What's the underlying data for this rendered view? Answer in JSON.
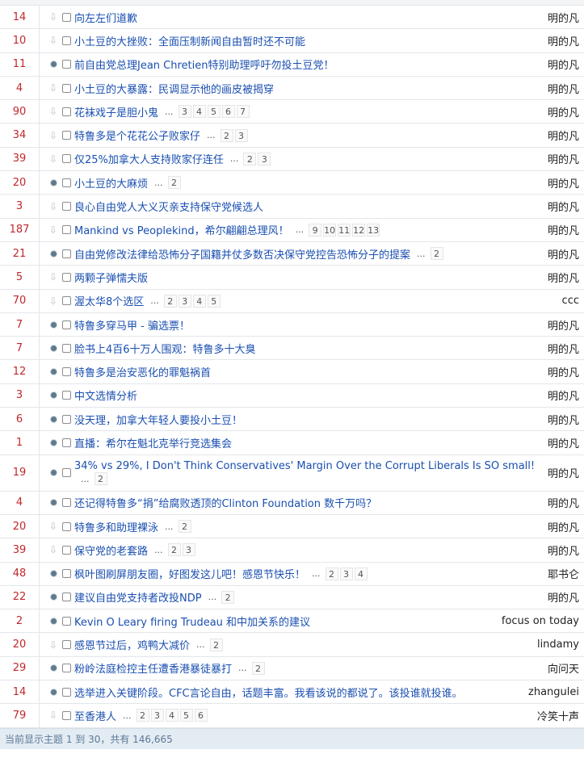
{
  "topics": [
    {
      "count": "14",
      "icon": "arrow",
      "title": "向左左们道歉",
      "pages": [],
      "author": "明的凡"
    },
    {
      "count": "10",
      "icon": "arrow",
      "title": "小土豆的大挫败：全面压制新闻自由暂时还不可能",
      "pages": [],
      "author": "明的凡"
    },
    {
      "count": "11",
      "icon": "dot",
      "title": "前自由党总理Jean Chretien特别助理呼吁勿投土豆党！",
      "pages": [],
      "author": "明的凡"
    },
    {
      "count": "4",
      "icon": "arrow",
      "title": "小土豆的大暴露：民调显示他的画皮被揭穿",
      "pages": [],
      "author": "明的凡"
    },
    {
      "count": "90",
      "icon": "arrow",
      "title": "花袜戏子是胆小鬼",
      "pages": [
        "3",
        "4",
        "5",
        "6",
        "7"
      ],
      "author": "明的凡"
    },
    {
      "count": "34",
      "icon": "arrow",
      "title": "特鲁多是个花花公子败家仔",
      "pages": [
        "2",
        "3"
      ],
      "author": "明的凡"
    },
    {
      "count": "39",
      "icon": "arrow",
      "title": "仅25%加拿大人支持败家仔连任",
      "pages": [
        "2",
        "3"
      ],
      "author": "明的凡"
    },
    {
      "count": "20",
      "icon": "dot",
      "title": "小土豆的大麻烦",
      "pages": [
        "2"
      ],
      "author": "明的凡"
    },
    {
      "count": "3",
      "icon": "arrow",
      "title": "良心自由党人大义灭亲支持保守党候选人",
      "pages": [],
      "author": "明的凡"
    },
    {
      "count": "187",
      "icon": "arrow",
      "title": "Mankind vs Peoplekind，希尔翩翩总理风！",
      "pages": [
        "9",
        "10",
        "11",
        "12",
        "13"
      ],
      "author": "明的凡"
    },
    {
      "count": "21",
      "icon": "dot",
      "title": "自由党修改法律给恐怖分子国籍并仗多数否决保守党控告恐怖分子的提案",
      "pages": [
        "2"
      ],
      "author": "明的凡"
    },
    {
      "count": "5",
      "icon": "arrow",
      "title": "两颗子弹懦夫版",
      "pages": [],
      "author": "明的凡"
    },
    {
      "count": "70",
      "icon": "arrow",
      "title": "渥太华8个选区",
      "pages": [
        "2",
        "3",
        "4",
        "5"
      ],
      "author": "ccc"
    },
    {
      "count": "7",
      "icon": "dot",
      "title": "特鲁多穿马甲 - 骗选票！",
      "pages": [],
      "author": "明的凡"
    },
    {
      "count": "7",
      "icon": "dot",
      "title": "脸书上4百6十万人围观：特鲁多十大臭",
      "pages": [],
      "author": "明的凡"
    },
    {
      "count": "12",
      "icon": "dot",
      "title": "特鲁多是治安恶化的罪魁祸首",
      "pages": [],
      "author": "明的凡"
    },
    {
      "count": "3",
      "icon": "dot",
      "title": "中文选情分析",
      "pages": [],
      "author": "明的凡"
    },
    {
      "count": "6",
      "icon": "dot",
      "title": "没天理，加拿大年轻人要投小土豆！",
      "pages": [],
      "author": "明的凡"
    },
    {
      "count": "1",
      "icon": "dot",
      "title": "直播：希尔在魁北克举行竞选集会",
      "pages": [],
      "author": "明的凡"
    },
    {
      "count": "19",
      "icon": "dot",
      "title": "34% vs 29%, I Don't Think Conservatives' Margin Over the Corrupt Liberals Is SO small!",
      "pages": [
        "2"
      ],
      "author": "明的凡",
      "tall": true
    },
    {
      "count": "4",
      "icon": "dot",
      "title": "还记得特鲁多“捐”给腐败透顶的Clinton Foundation 数千万吗？",
      "pages": [],
      "author": "明的凡"
    },
    {
      "count": "20",
      "icon": "arrow",
      "title": "特鲁多和助理裸泳",
      "pages": [
        "2"
      ],
      "author": "明的凡"
    },
    {
      "count": "39",
      "icon": "arrow",
      "title": "保守党的老套路",
      "pages": [
        "2",
        "3"
      ],
      "author": "明的凡"
    },
    {
      "count": "48",
      "icon": "dot",
      "title": "枫叶图刷屏朋友圈，好图发这儿吧！感恩节快乐！",
      "pages": [
        "2",
        "3",
        "4"
      ],
      "author": "耶书仑"
    },
    {
      "count": "22",
      "icon": "dot",
      "title": "建议自由党支持者改投NDP",
      "pages": [
        "2"
      ],
      "author": "明的凡"
    },
    {
      "count": "2",
      "icon": "dot",
      "title": "Kevin O Leary firing Trudeau 和中加关系的建议",
      "pages": [],
      "author": "focus on today"
    },
    {
      "count": "20",
      "icon": "arrow",
      "title": "感恩节过后，鸡鸭大减价",
      "pages": [
        "2"
      ],
      "author": "lindamy"
    },
    {
      "count": "29",
      "icon": "dot",
      "title": "粉岭法庭检控主任遭香港暴徒暴打",
      "pages": [
        "2"
      ],
      "author": "向问天"
    },
    {
      "count": "14",
      "icon": "dot",
      "title": "选举进入关键阶段。CFC言论自由，话题丰富。我看该说的都说了。该投谁就投谁。",
      "pages": [],
      "author": "zhangulei"
    },
    {
      "count": "79",
      "icon": "arrow",
      "title": "至香港人",
      "pages": [
        "2",
        "3",
        "4",
        "5",
        "6"
      ],
      "author": "冷笑十声"
    }
  ],
  "ellipsis": "...",
  "footer": "当前显示主题 1 到 30，共有 146,665"
}
